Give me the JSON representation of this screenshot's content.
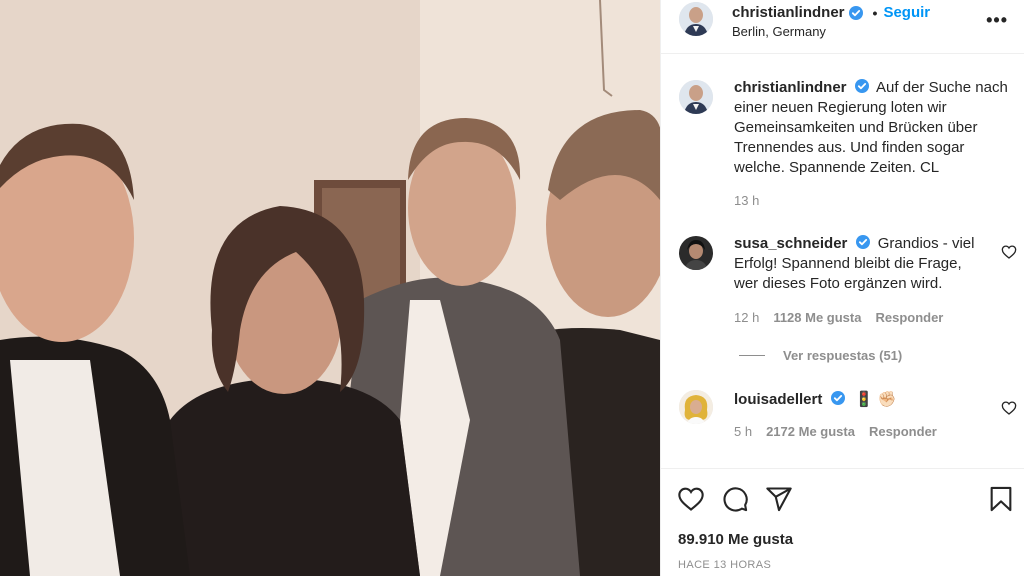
{
  "post": {
    "author": "christianlindner",
    "follow_label": "Seguir",
    "location": "Berlin, Germany",
    "more_label": "•••",
    "dot": "•"
  },
  "caption": {
    "user": "christianlindner",
    "text": "Auf der Suche nach einer neuen Regierung loten wir Gemeinsamkeiten und Brücken über Trennendes aus. Und finden sogar welche. Spannende Zeiten. CL",
    "time": "13 h"
  },
  "comments": [
    {
      "user": "susa_schneider",
      "text": "Grandios - viel Erfolg! Spannend bleibt die Frage, wer dieses Foto ergänzen wird.",
      "time": "12 h",
      "likes": "1128 Me gusta",
      "reply_label": "Responder"
    },
    {
      "user": "louisadellert",
      "text": "🚦 ✊🏻",
      "time": "5 h",
      "likes": "2172 Me gusta",
      "reply_label": "Responder"
    }
  ],
  "view_replies": "Ver respuestas (51)",
  "footer": {
    "likes": "89.910 Me gusta",
    "date": "HACE 13 HORAS"
  },
  "colors": {
    "accent": "#0095f6",
    "verified": "#3897f0",
    "muted": "#8e8e8e"
  },
  "icons": [
    "heart-icon",
    "comment-icon",
    "share-icon",
    "bookmark-icon",
    "verified-badge-icon",
    "more-options-icon"
  ]
}
